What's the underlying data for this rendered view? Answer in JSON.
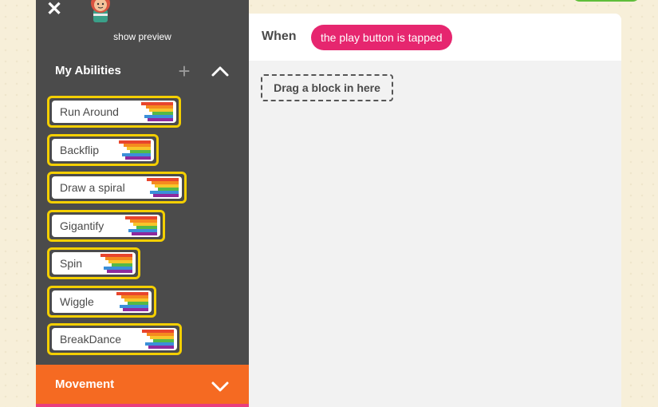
{
  "window": {
    "close_label": "✕",
    "preview_label": "show preview"
  },
  "abilities": {
    "title": "My Abilities",
    "add_label": "+",
    "items": [
      {
        "label": "Run Around"
      },
      {
        "label": "Backflip"
      },
      {
        "label": "Draw a spiral"
      },
      {
        "label": "Gigantify"
      },
      {
        "label": "Spin"
      },
      {
        "label": "Wiggle"
      },
      {
        "label": "BreakDance"
      }
    ]
  },
  "categories": {
    "movement_label": "Movement"
  },
  "script": {
    "when_label": "When",
    "trigger_label": "the play button is tapped",
    "drop_zone_label": "Drag a block in here"
  },
  "colors": {
    "sidebar": "#4b4b4b",
    "ability_border": "#f4cf00",
    "trigger_pink": "#e6266f",
    "movement_orange": "#f56a22",
    "rainbow": [
      "#e8452c",
      "#f58a1f",
      "#f7c52a",
      "#55b947",
      "#3b8fd9",
      "#8e2a9e"
    ]
  }
}
